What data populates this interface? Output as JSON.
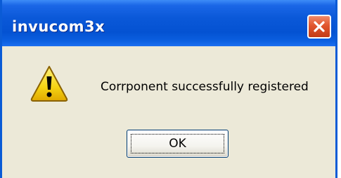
{
  "dialog": {
    "title": "invucom3x",
    "message": "Corrponent successfully registered",
    "icon": "warning-icon",
    "ok_label": "OK",
    "close_icon": "close-icon"
  },
  "colors": {
    "titlebar": "#0a58d8",
    "title_text": "#ffffff",
    "dialog_background": "#ece9d8",
    "close_button": "#e1552d",
    "warning_yellow": "#f5d313"
  }
}
